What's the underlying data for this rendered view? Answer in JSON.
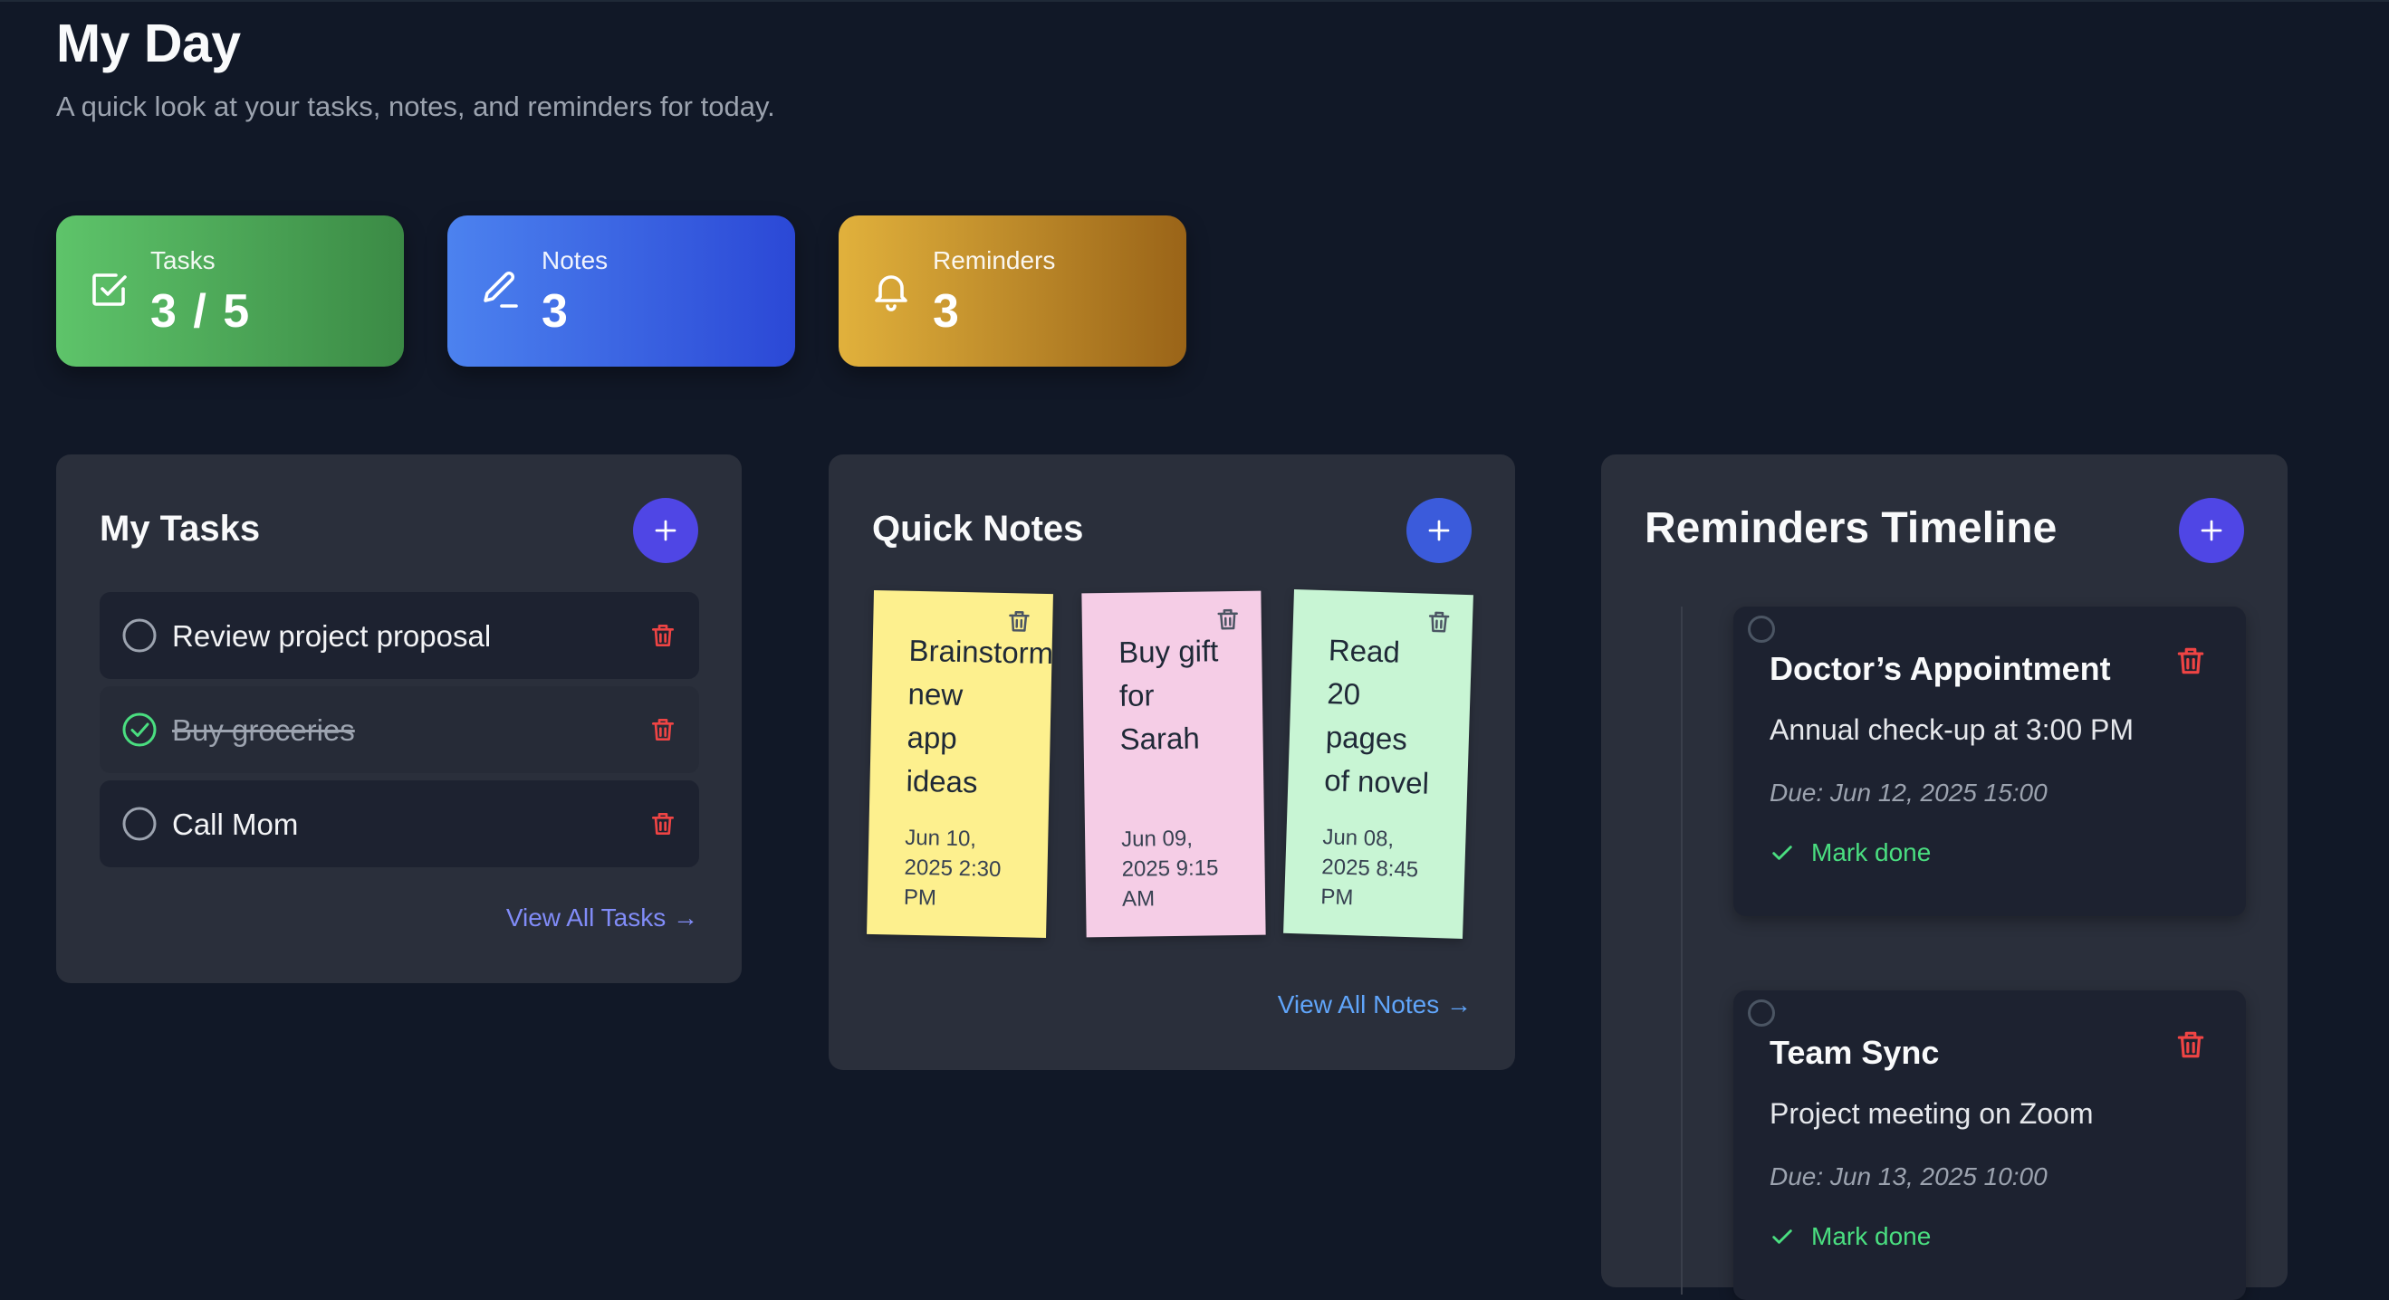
{
  "header": {
    "title": "My Day",
    "subtitle": "A quick look at your tasks, notes, and reminders for today."
  },
  "stats": [
    {
      "label": "Tasks",
      "value": "3 / 5",
      "icon": "checkbox-icon",
      "color_from": "#5ec46a",
      "color_to": "#3b8a45"
    },
    {
      "label": "Notes",
      "value": "3",
      "icon": "pencil-icon",
      "color_from": "#4c82ef",
      "color_to": "#2b48d6"
    },
    {
      "label": "Reminders",
      "value": "3",
      "icon": "bell-icon",
      "color_from": "#e1b13c",
      "color_to": "#9a6418"
    }
  ],
  "tasks_panel": {
    "title": "My Tasks",
    "items": [
      {
        "label": "Review project proposal",
        "done": false
      },
      {
        "label": "Buy groceries",
        "done": true
      },
      {
        "label": "Call Mom",
        "done": false
      }
    ],
    "view_all": "View All Tasks →"
  },
  "notes_panel": {
    "title": "Quick Notes",
    "notes": [
      {
        "text": "Brainstorm\nnew\napp\nideas",
        "date": "Jun 10,\n2025 2:30\nPM",
        "color": "#fdf08e"
      },
      {
        "text": "Buy gift\nfor\nSarah",
        "date": "Jun 09,\n2025 9:15\nAM",
        "color": "#f5cde6"
      },
      {
        "text": "Read\n20\npages\nof novel",
        "date": "Jun 08,\n2025 8:45\nPM",
        "color": "#c8f5d4"
      }
    ],
    "view_all": "View All Notes →"
  },
  "reminders_panel": {
    "title": "Reminders Timeline",
    "items": [
      {
        "title": "Doctor’s Appointment",
        "description": "Annual check-up at 3:00 PM",
        "due": "Due: Jun 12, 2025 15:00",
        "action": "Mark done"
      },
      {
        "title": "Team Sync",
        "description": "Project meeting on Zoom",
        "due": "Due: Jun 13, 2025 10:00",
        "action": "Mark done"
      }
    ]
  },
  "colors": {
    "background": "#111827",
    "panel": "#2a2f3b",
    "accent": "#4f46e5",
    "danger": "#ef4444",
    "success": "#4ade80",
    "link": "#818cf8"
  }
}
